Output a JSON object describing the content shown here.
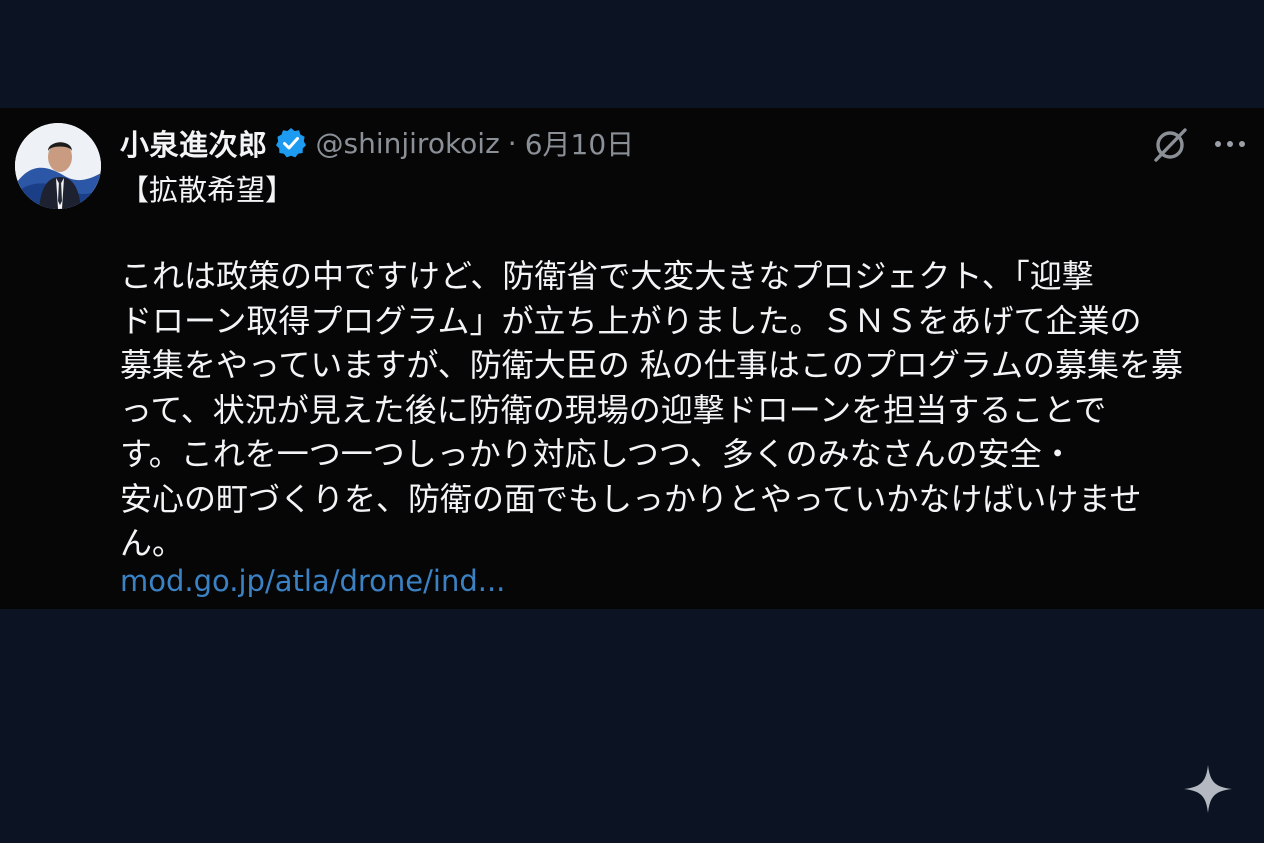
{
  "tweet": {
    "author": {
      "name": "小泉進次郎",
      "handle": "@shinjirokoiz",
      "verified": true
    },
    "separator": "·",
    "date": "6月10日",
    "tag": "【拡散希望】",
    "body_lines": [
      "これは政策の中ですけど、防衛省で大変大きなプロジェクト、「迎撃",
      "ドローン取得プログラム」が立ち上がりました。ＳＮＳをあげて企業の",
      "募集をやっていますが、防衛大臣の 私の仕事はこのプログラムの募集を募",
      "って、状況が見えた後に防衛の現場の迎撃ドローンを担当することで",
      "す。これを一つ一つしっかり対応しつつ、多くのみなさんの安全・",
      "安心の町づくりを、防衛の面でもしっかりとやっていかなけばいけませ",
      "ん。"
    ],
    "link": "mod.go.jp/atla/drone/ind...",
    "icons": [
      "verified-badge-icon",
      "grok-icon",
      "more-icon",
      "sparkle-icon"
    ],
    "colors": {
      "page_background": "#0c1322",
      "tweet_background": "#060607",
      "text": "#f3f4f6",
      "muted": "#8b9097",
      "link": "#3b82c4",
      "verified": "#1d9bf0"
    }
  }
}
